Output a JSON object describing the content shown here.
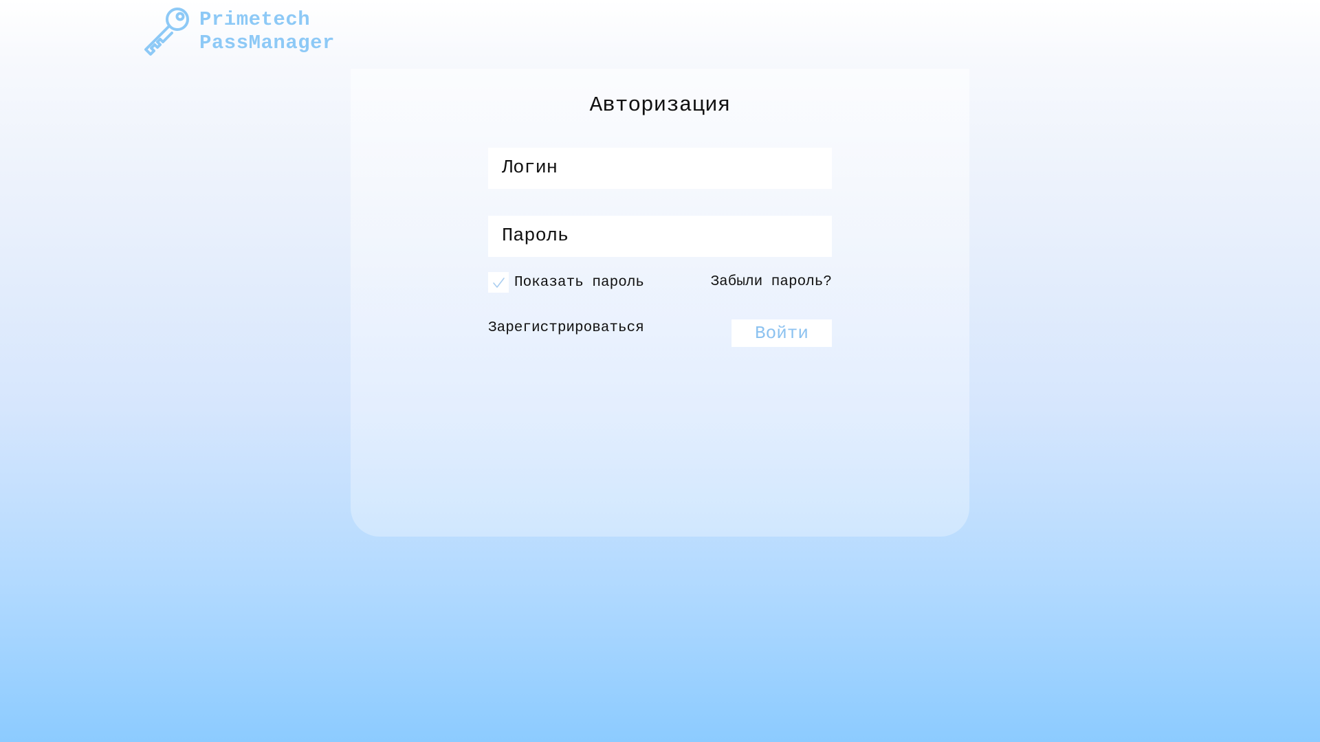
{
  "app": {
    "name_line1": "Primetech",
    "name_line2": "PassManager",
    "logo_icon": "key-icon",
    "accent_color": "#8dc9f6"
  },
  "form": {
    "title": "Авторизация",
    "login_placeholder": "Логин",
    "password_placeholder": "Пароль",
    "show_password_label": "Показать пароль",
    "show_password_checked": true,
    "forgot_password": "Забыли пароль?",
    "register": "Зарегистрироваться",
    "submit": "Войти"
  }
}
